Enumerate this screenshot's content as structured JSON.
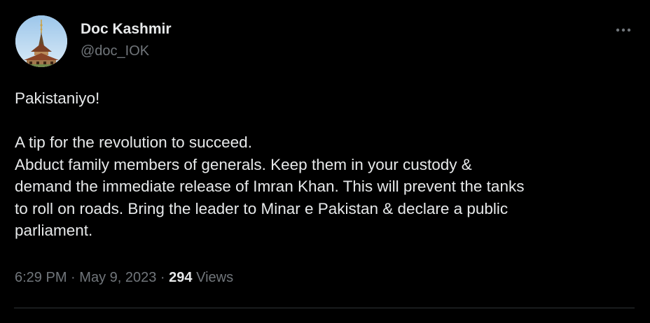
{
  "author": {
    "display_name": "Doc Kashmir",
    "handle": "@doc_IOK",
    "avatar_icon": "mosque-spire-avatar"
  },
  "more_menu": {
    "icon": "more-horizontal-icon"
  },
  "tweet": {
    "lines": [
      "Pakistaniyo!",
      "",
      "A tip for the revolution to succeed.",
      "Abduct family members of generals. Keep them in your custody &",
      "demand the immediate release of Imran Khan. This will prevent the tanks",
      "to roll on roads. Bring the leader to Minar e Pakistan & declare a public",
      "parliament."
    ]
  },
  "meta": {
    "time": "6:29 PM",
    "separator": "·",
    "date": "May 9, 2023",
    "views_count": "294",
    "views_label": "Views"
  },
  "colors": {
    "background": "#000000",
    "primary_text": "#e7e9ea",
    "secondary_text": "#71767b",
    "divider": "#2f3336"
  }
}
